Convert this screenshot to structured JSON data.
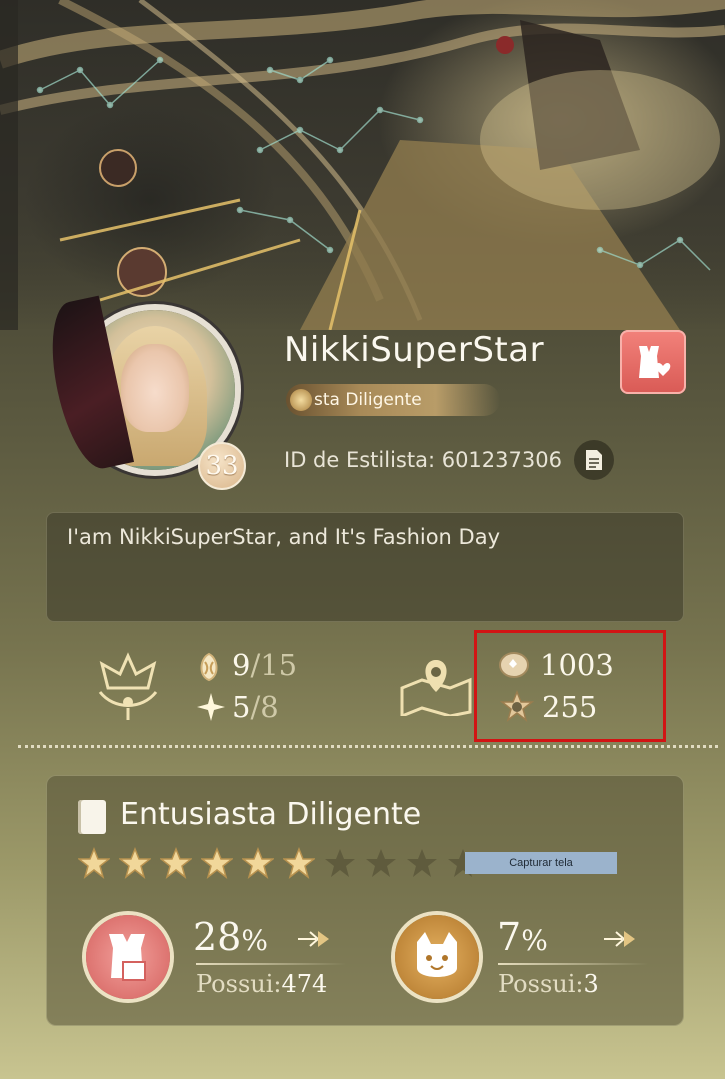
{
  "profile": {
    "name": "NikkiSuperStar",
    "title_badge": "sta Diligente",
    "level": "33",
    "id_line": "ID de Estilista: 601237306",
    "bio": "I'am NikkiSuperStar, and It's Fashion Day"
  },
  "stats": {
    "slot_a": {
      "value": "9",
      "total": "/15",
      "icon": "crystal-icon"
    },
    "slot_b": {
      "value": "5",
      "total": "/8",
      "icon": "sparkle-icon"
    },
    "coins": {
      "value": "1003",
      "icon": "stone-icon"
    },
    "stars": {
      "value": "255",
      "icon": "star-badge-icon"
    }
  },
  "collection": {
    "title": "Entusiasta Diligente",
    "stars_filled": 6,
    "stars_total": 10,
    "outfits": {
      "percent": "28",
      "unit": "%",
      "own_label": "Possui:",
      "own_count": "474"
    },
    "pets": {
      "percent": "7",
      "unit": "%",
      "own_label": "Possui:",
      "own_count": "3"
    }
  },
  "overlay": {
    "tooltip": "Capturar tela"
  },
  "colors": {
    "fav_button": "#e06a63",
    "outfit_icon_bg": "#e07d7a",
    "pet_icon_bg": "#c88a3e",
    "highlight_border": "#d21414"
  }
}
